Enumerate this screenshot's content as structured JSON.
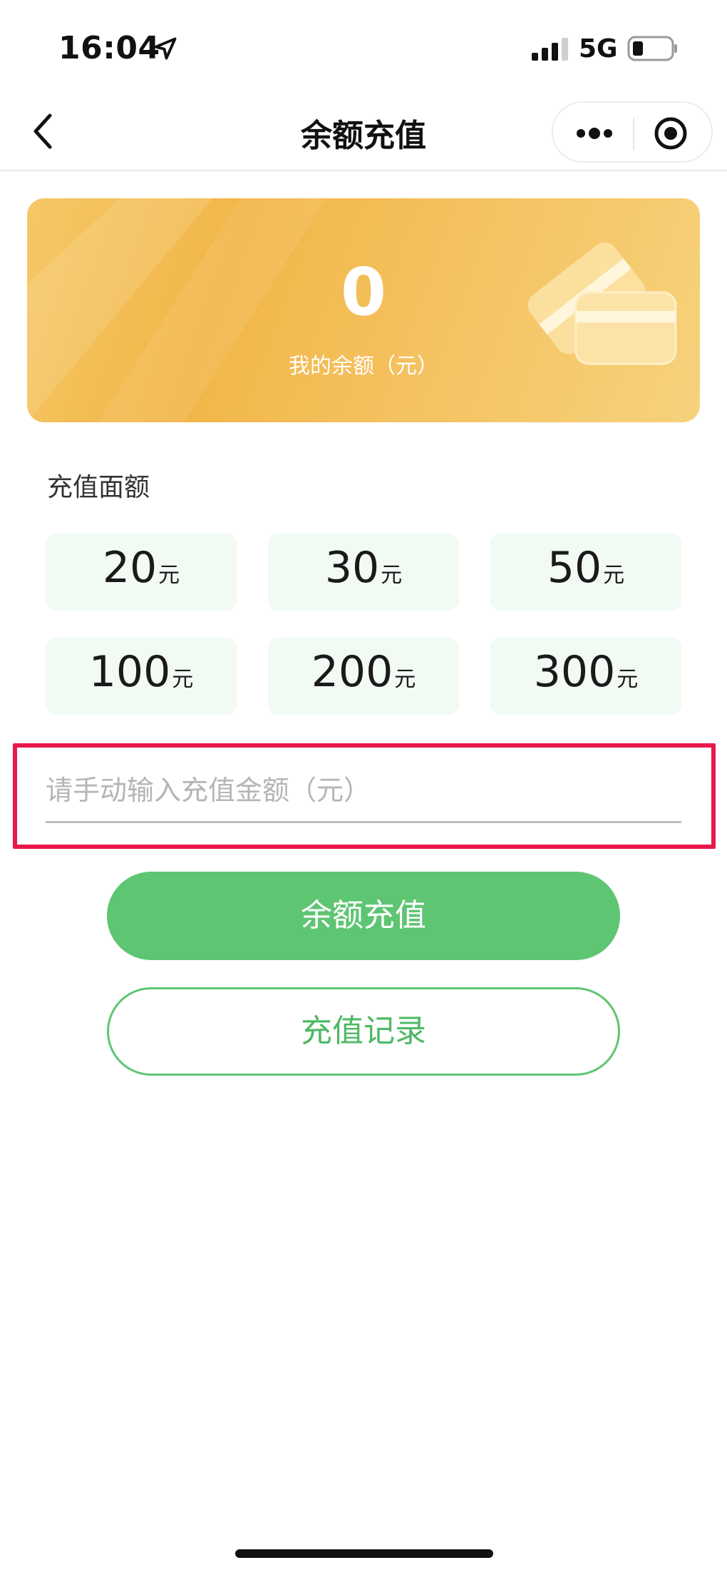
{
  "status_bar": {
    "time": "16:04",
    "network": "5G",
    "icons": [
      "location-arrow-icon",
      "signal-icon",
      "battery-icon"
    ]
  },
  "nav": {
    "title": "余额充值",
    "icons": [
      "back-icon",
      "more-icon",
      "target-icon"
    ]
  },
  "balance_card": {
    "value": "0",
    "label": "我的余额（元）",
    "icon": "wallet-cards-icon"
  },
  "section": {
    "title": "充值面额"
  },
  "amounts": [
    {
      "value": "20",
      "unit": "元"
    },
    {
      "value": "30",
      "unit": "元"
    },
    {
      "value": "50",
      "unit": "元"
    },
    {
      "value": "100",
      "unit": "元"
    },
    {
      "value": "200",
      "unit": "元"
    },
    {
      "value": "300",
      "unit": "元"
    }
  ],
  "manual_input": {
    "value": "",
    "placeholder": "请手动输入充值金额（元）"
  },
  "buttons": {
    "recharge": "余额充值",
    "records": "充值记录"
  },
  "colors": {
    "accent_green": "#5ec572",
    "card_gold": "#f4c260",
    "amount_bg": "#f2faf4",
    "highlight_red": "#e8194a"
  }
}
